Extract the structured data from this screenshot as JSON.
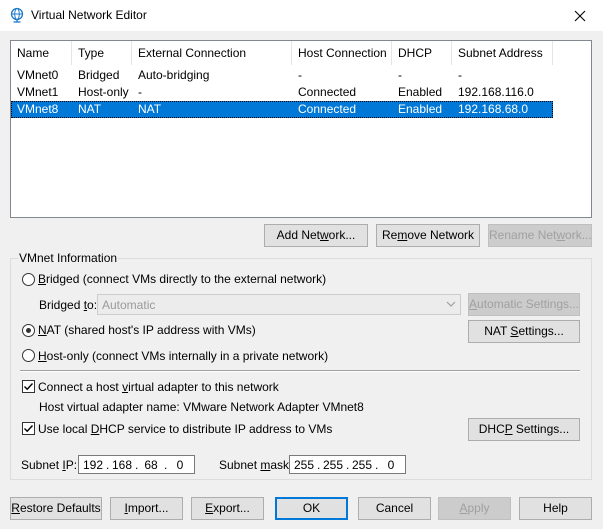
{
  "window": {
    "title": "Virtual Network Editor",
    "icon": "network-globe-icon",
    "close": "close-icon"
  },
  "list": {
    "columns": [
      "Name",
      "Type",
      "External Connection",
      "Host Connection",
      "DHCP",
      "Subnet Address"
    ],
    "rows": [
      {
        "name": "VMnet0",
        "type": "Bridged",
        "external": "Auto-bridging",
        "host": "-",
        "dhcp": "-",
        "subnet": "-"
      },
      {
        "name": "VMnet1",
        "type": "Host-only",
        "external": "-",
        "host": "Connected",
        "dhcp": "Enabled",
        "subnet": "192.168.116.0"
      },
      {
        "name": "VMnet8",
        "type": "NAT",
        "external": "NAT",
        "host": "Connected",
        "dhcp": "Enabled",
        "subnet": "192.168.68.0",
        "selected": true
      }
    ]
  },
  "list_buttons": {
    "add": {
      "pre": "Add Net",
      "key": "w",
      "post": "ork..."
    },
    "remove": {
      "pre": "Re",
      "key": "m",
      "post": "ove Network"
    },
    "rename": {
      "pre": "Rename Net",
      "key": "w",
      "post": "ork...",
      "disabled": true
    }
  },
  "vmnet_info": {
    "legend": "VMnet Information",
    "bridged": {
      "key": "B",
      "post": "ridged (connect VMs directly to the external network)",
      "checked": false
    },
    "bridged_to_label": {
      "pre": "Bridged ",
      "key": "t",
      "post": "o:"
    },
    "bridged_to_value": "Automatic",
    "auto_settings": {
      "key": "A",
      "post": "utomatic Settings...",
      "disabled": true
    },
    "nat": {
      "key": "N",
      "post": "AT (shared host's IP address with VMs)",
      "checked": true
    },
    "nat_settings": {
      "pre": "NAT ",
      "key": "S",
      "post": "ettings..."
    },
    "hostonly": {
      "key": "H",
      "post": "ost-only (connect VMs internally in a private network)",
      "checked": false
    },
    "connect_adapter": {
      "pre": "Connect a host ",
      "key": "v",
      "post": "irtual adapter to this network",
      "checked": true
    },
    "adapter_name_label": "Host virtual adapter name: VMware Network Adapter VMnet8",
    "use_dhcp": {
      "pre": "Use local ",
      "key": "D",
      "post": "HCP service to distribute IP address to VMs",
      "checked": true
    },
    "dhcp_settings": {
      "pre": "DHC",
      "key": "P",
      "post": " Settings..."
    },
    "subnet_ip_label": {
      "pre": "Subnet ",
      "key": "I",
      "post": "P:"
    },
    "subnet_ip": [
      "192",
      "168",
      "68",
      "0"
    ],
    "subnet_mask_label": {
      "pre": "Subnet ",
      "key": "m",
      "post": "ask:"
    },
    "subnet_mask": [
      "255",
      "255",
      "255",
      "0"
    ]
  },
  "bottom_buttons": {
    "restore": {
      "pre": "",
      "key": "R",
      "post": "estore Defaults"
    },
    "import": {
      "pre": "",
      "key": "I",
      "post": "mport..."
    },
    "export": {
      "pre": "",
      "key": "E",
      "post": "xport..."
    },
    "ok": "OK",
    "cancel": "Cancel",
    "apply": {
      "pre": "",
      "key": "A",
      "post": "pply",
      "disabled": true
    },
    "help": "Help"
  },
  "colors": {
    "selection": "#0078d7",
    "window_bg": "#f0f0f0",
    "disabled_text": "#a0a0a0"
  }
}
